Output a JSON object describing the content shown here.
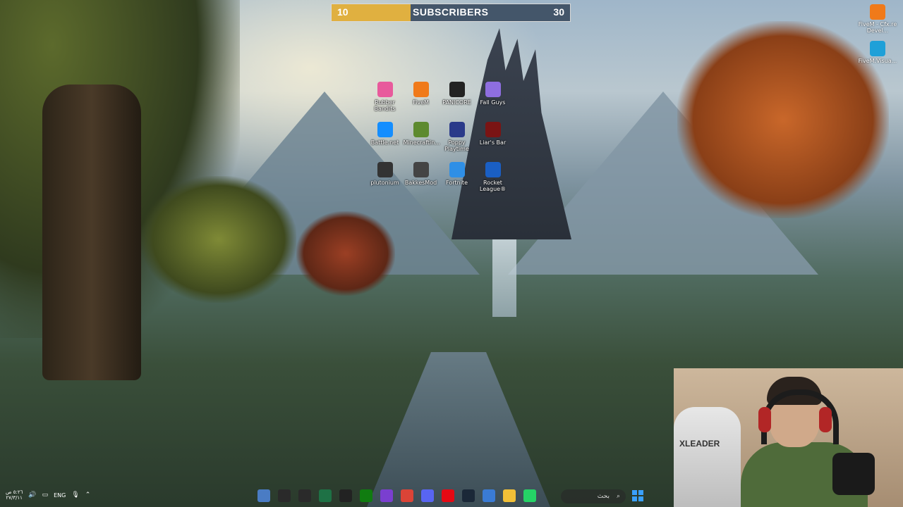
{
  "subscriber_bar": {
    "current": "10",
    "label": "SUBSCRIBERS",
    "goal": "30",
    "progress_fraction": 0.33,
    "fill_color": "#e0b040"
  },
  "desktop_icons": [
    {
      "label": "Rubber Bandits",
      "icon": "rubber-bandits-icon",
      "color": "#e85a9c"
    },
    {
      "label": "FiveM",
      "icon": "fivem-icon",
      "color": "#f07a1a"
    },
    {
      "label": "PANICORE",
      "icon": "panicore-icon",
      "color": "#222222"
    },
    {
      "label": "Fall Guys",
      "icon": "fall-guys-icon",
      "color": "#8e6ee0"
    },
    {
      "label": "Battle.net",
      "icon": "battle-net-icon",
      "color": "#148eff"
    },
    {
      "label": "Minecraftin...",
      "icon": "minecraft-icon",
      "color": "#5d8a2f"
    },
    {
      "label": "Poppy Playtime",
      "icon": "poppy-playtime-icon",
      "color": "#2a3a8a"
    },
    {
      "label": "Liar's Bar",
      "icon": "liars-bar-icon",
      "color": "#7a1414"
    },
    {
      "label": "plutonium",
      "icon": "plutonium-icon",
      "color": "#333333"
    },
    {
      "label": "BakkesMod",
      "icon": "bakkesmod-icon",
      "color": "#444444"
    },
    {
      "label": "Fortnite",
      "icon": "fortnite-icon",
      "color": "#2f8fe6"
    },
    {
      "label": "Rocket League®",
      "icon": "rocket-league-icon",
      "color": "#1a5fc4"
    }
  ],
  "right_icons": [
    {
      "label": "FiveM - Cfx.re Devel...",
      "icon": "fivem-dev-icon",
      "color": "#f07a1a"
    },
    {
      "label": "FiveM.Visua...",
      "icon": "edge-icon",
      "color": "#1fa0d8"
    }
  ],
  "webcam": {
    "chair_logo": "XLEADER"
  },
  "taskbar": {
    "time": "٥:٢٦ ص",
    "date": "٢٧/٣/١١",
    "language": "ENG",
    "search_placeholder": "بحث",
    "apps": [
      {
        "icon": "settings-icon",
        "color": "#4a7cc4"
      },
      {
        "icon": "obs-icon",
        "color": "#2a2a2a"
      },
      {
        "icon": "epic-games-icon",
        "color": "#2a2a2a"
      },
      {
        "icon": "excel-icon",
        "color": "#1e7145"
      },
      {
        "icon": "g-hub-icon",
        "color": "#222222"
      },
      {
        "icon": "xbox-icon",
        "color": "#107c10"
      },
      {
        "icon": "game-controller-icon",
        "color": "#7a3fd0"
      },
      {
        "icon": "chrome-icon",
        "color": "#db4437"
      },
      {
        "icon": "discord-icon",
        "color": "#5865f2"
      },
      {
        "icon": "netflix-icon",
        "color": "#e50914"
      },
      {
        "icon": "steam-icon",
        "color": "#1b2838"
      },
      {
        "icon": "store-icon",
        "color": "#3a7bd5"
      },
      {
        "icon": "file-explorer-icon",
        "color": "#f2c037"
      },
      {
        "icon": "whatsapp-icon",
        "color": "#25d366"
      }
    ]
  }
}
